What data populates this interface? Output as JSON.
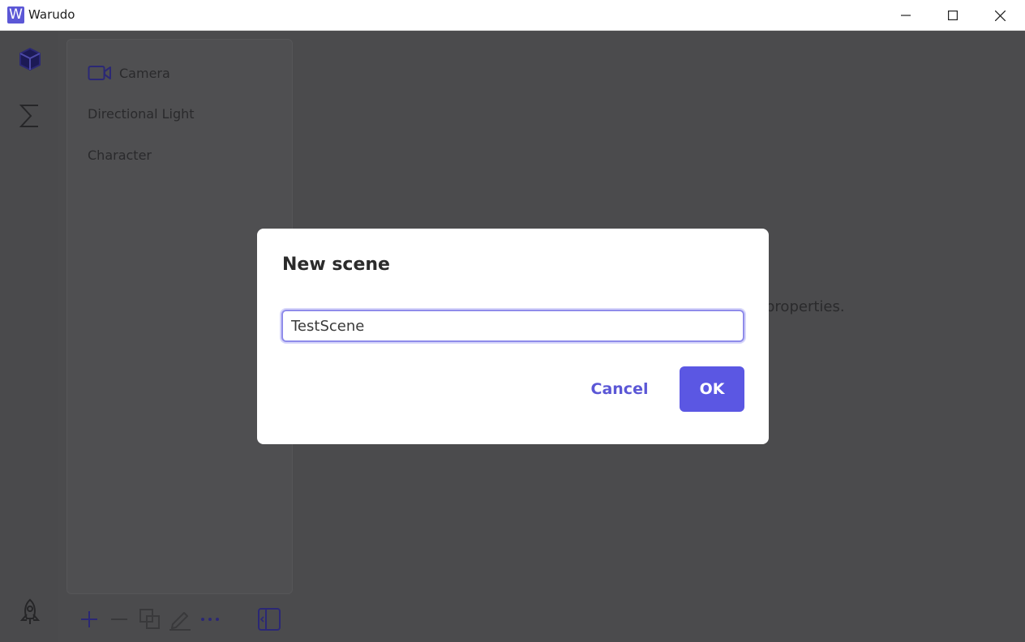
{
  "window": {
    "app_icon_letter": "W",
    "title": "Warudo"
  },
  "scene_panel": {
    "items": [
      {
        "label": "Camera",
        "icon": "video-camera-icon"
      },
      {
        "label": "Directional Light"
      },
      {
        "label": "Character"
      }
    ]
  },
  "background": {
    "hint_fragment": "properties."
  },
  "dialog": {
    "title": "New scene",
    "input_value": "TestScene",
    "cancel_label": "Cancel",
    "ok_label": "OK"
  },
  "colors": {
    "accent": "#5b57e3",
    "overlay": "#4b4b4d"
  }
}
